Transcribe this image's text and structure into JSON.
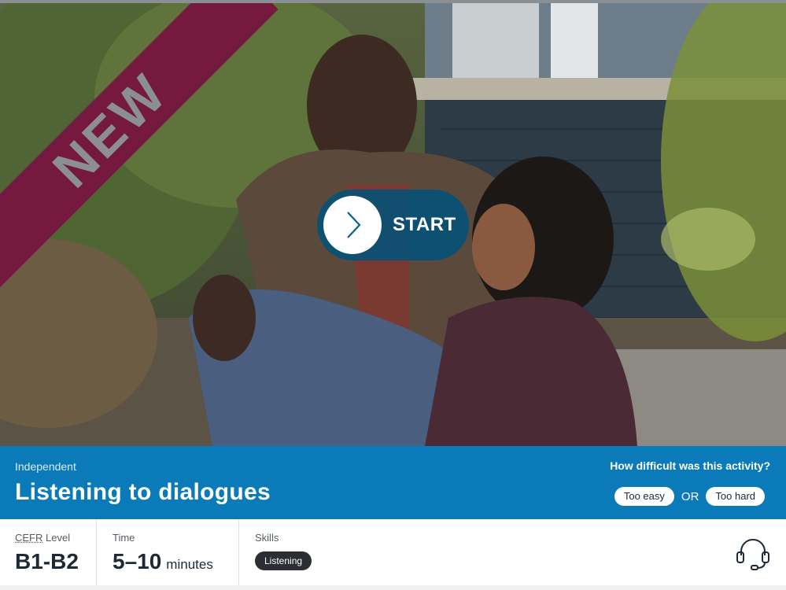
{
  "ribbon": {
    "text": "NEW"
  },
  "start_button": {
    "label": "START"
  },
  "activity": {
    "category": "Independent",
    "title": "Listening to dialogues"
  },
  "feedback": {
    "question": "How difficult was this activity?",
    "too_easy": "Too easy",
    "or": "OR",
    "too_hard": "Too hard"
  },
  "details": {
    "cefr_abbr": "CEFR",
    "cefr_label_rest": " Level",
    "cefr_value": "B1-B2",
    "time_label": "Time",
    "time_value": "5–10",
    "time_unit": "minutes",
    "skills_label": "Skills",
    "skill": "Listening"
  },
  "icons": {
    "play": "chevron-right-icon",
    "skill_type": "headset-icon"
  },
  "colors": {
    "ribbon": "#76193e",
    "bar": "#0a7ab8",
    "start_button": "#00527a"
  }
}
